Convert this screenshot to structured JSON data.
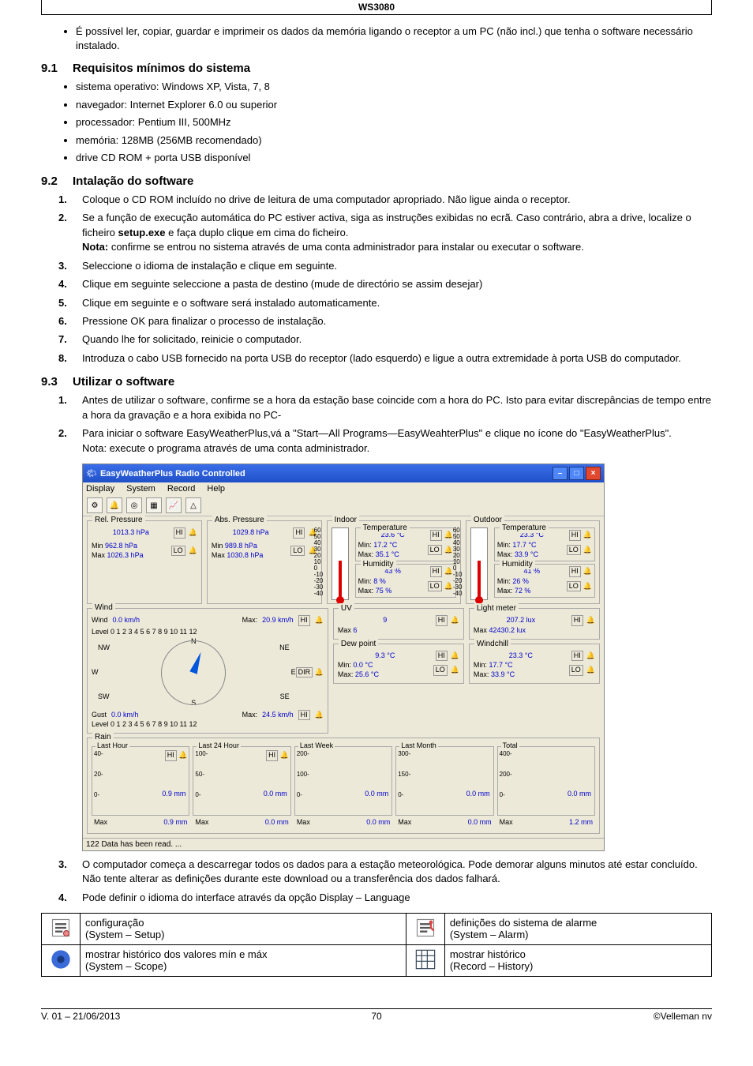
{
  "header": {
    "title": "WS3080"
  },
  "intro_bullet": "É possível ler, copiar, guardar e imprimeir os dados da memória ligando o receptor a um PC (não incl.) que tenha o software necessário instalado.",
  "section91": {
    "num": "9.1",
    "title": "Requisitos mínimos do sistema",
    "items": [
      "sistema operativo: Windows XP, Vista, 7, 8",
      "navegador: Internet Explorer 6.0 ou superior",
      "processador: Pentium III, 500MHz",
      "memória: 128MB (256MB recomendado)",
      "drive CD ROM + porta USB disponível"
    ]
  },
  "section92": {
    "num": "9.2",
    "title": "Intalação do software",
    "steps": [
      "Coloque o CD ROM incluído no drive de leitura de uma computador apropriado. Não ligue ainda o receptor.",
      "Se a função de execução automática do PC estiver activa, siga as instruções exibidas no ecrã. Caso contrário, abra a drive, localize o ficheiro <b>setup.exe</b> e faça duplo clique em cima do ficheiro.<br><b>Nota:</b> confirme se entrou no sistema através de uma conta administrador para instalar ou executar o software.",
      "Seleccione o idioma de instalação e clique em seguinte.",
      "Clique em seguinte seleccione a pasta de destino (mude de directório se assim desejar)",
      "Clique em seguinte e o software será instalado automaticamente.",
      "Pressione OK para finalizar o processo de instalação.",
      "Quando lhe for solicitado, reinicie o computador.",
      "Introduza o cabo USB fornecido na porta USB do receptor (lado esquerdo) e ligue a outra extremidade à porta USB do computador."
    ]
  },
  "section93": {
    "num": "9.3",
    "title": "Utilizar o software",
    "steps": [
      "Antes de utilizar o software, confirme se a hora da estação base coincide com a hora do PC. Isto para evitar discrepâncias de tempo entre a hora da gravação e a hora exibida no PC-",
      "Para iniciar o software EasyWeatherPlus,vá a \"Start—All Programs—EasyWeahterPlus\" e clique no ícone do \"EasyWeatherPlus\".<br>Nota: execute o programa através de uma conta administrador."
    ],
    "steps2": [
      "O computador começa a descarregar todos os dados para a estação meteorológica. Pode demorar alguns minutos até estar concluído. Não tente alterar as definições durante este download ou a transferência dos dados falhará.",
      "Pode definir o idioma do interface através da opção Display – Language"
    ]
  },
  "app": {
    "title": "EasyWeatherPlus Radio Controlled",
    "menu": [
      "Display",
      "System",
      "Record",
      "Help"
    ],
    "rel_pressure": {
      "legend": "Rel. Pressure",
      "value": "1013.3 hPa",
      "hi": "HI",
      "min_label": "Min",
      "min": "962.8 hPa",
      "max_label": "Max",
      "max": "1026.3 hPa",
      "lo": "LO"
    },
    "abs_pressure": {
      "legend": "Abs. Pressure",
      "value": "1029.8 hPa",
      "hi": "HI",
      "min_label": "Min",
      "min": "989.8 hPa",
      "max_label": "Max",
      "max": "1030.8 hPa",
      "lo": "LO"
    },
    "wind": {
      "legend": "Wind",
      "label": "Wind",
      "value": "0.0 km/h",
      "max_label": "Max:",
      "max": "20.9 km/h",
      "hi": "HI",
      "level_label": "Level",
      "dir_label": "DIR",
      "dirs": {
        "n": "N",
        "ne": "NE",
        "e": "E",
        "se": "SE",
        "s": "S",
        "sw": "SW",
        "w": "W",
        "nw": "NW"
      },
      "gust_label": "Gust",
      "gust": "0.0 km/h",
      "gust_max_label": "Max:",
      "gust_max": "24.5 km/h",
      "gust_hi": "HI",
      "scale": "0  1  2  3  4  5  6  7  8  9  10  11  12"
    },
    "indoor": {
      "legend": "Indoor",
      "temp_legend": "Temperature",
      "temp": "23.6 °C",
      "hi": "HI",
      "lo": "LO",
      "min_label": "Min:",
      "min": "17.2 °C",
      "max_label": "Max:",
      "max": "35.1 °C",
      "hum_legend": "Humidity",
      "hum": "43 %",
      "hum_min_label": "Min:",
      "hum_min": "8 %",
      "hum_max_label": "Max:",
      "hum_max": "75 %",
      "ticks": "60\n50\n40\n30\n20\n10\n0\n-10\n-20\n-30\n-40"
    },
    "outdoor": {
      "legend": "Outdoor",
      "temp_legend": "Temperature",
      "temp": "23.3 °C",
      "hi": "HI",
      "lo": "LO",
      "min_label": "Min:",
      "min": "17.7 °C",
      "max_label": "Max:",
      "max": "33.9 °C",
      "hum_legend": "Humidity",
      "hum": "41 %",
      "hum_min_label": "Min:",
      "hum_min": "26 %",
      "hum_max_label": "Max:",
      "hum_max": "72 %"
    },
    "uv": {
      "legend": "UV",
      "value": "9",
      "max_label": "Max",
      "max": "6",
      "hi": "HI"
    },
    "light": {
      "legend": "Light meter",
      "value": "207.2 lux",
      "max_label": "Max",
      "max": "42430.2 lux",
      "hi": "HI"
    },
    "dew": {
      "legend": "Dew point",
      "value": "9.3 °C",
      "hi": "HI",
      "min_label": "Min:",
      "min": "0.0 °C",
      "max_label": "Max:",
      "max": "25.6 °C",
      "lo": "LO"
    },
    "windchill": {
      "legend": "Windchill",
      "value": "23.3 °C",
      "hi": "HI",
      "min_label": "Min:",
      "min": "17.7 °C",
      "max_label": "Max:",
      "max": "33.9 °C",
      "lo": "LO"
    },
    "rain": {
      "legend": "Rain",
      "cols": [
        {
          "legend": "Last Hour",
          "hi": "HI",
          "value": "0.9 mm",
          "max_label": "Max",
          "max": "0.9 mm",
          "top": "40",
          "mid": "20",
          "bot": "0"
        },
        {
          "legend": "Last 24 Hour",
          "hi": "HI",
          "value": "0.0 mm",
          "max_label": "Max",
          "max": "0.0 mm",
          "top": "100",
          "mid": "50",
          "bot": "0"
        },
        {
          "legend": "Last Week",
          "value": "0.0 mm",
          "max_label": "Max",
          "max": "0.0 mm",
          "top": "200",
          "mid": "100",
          "bot": "0"
        },
        {
          "legend": "Last Month",
          "value": "0.0 mm",
          "max_label": "Max",
          "max": "0.0 mm",
          "top": "300",
          "mid": "150",
          "bot": "0"
        },
        {
          "legend": "Total",
          "value": "0.0 mm",
          "max_label": "Max",
          "max": "1.2 mm",
          "top": "400",
          "mid": "200",
          "bot": "0"
        }
      ]
    },
    "status": "122 Data has been read. ..."
  },
  "config_table": {
    "rows": [
      {
        "left": "configuração<br>(System – Setup)",
        "right": "definições do sistema de alarme<br>(System – Alarm)"
      },
      {
        "left": "mostrar histórico dos valores mín e máx<br>(System – Scope)",
        "right": "mostrar histórico<br>(Record – History)"
      }
    ]
  },
  "footer": {
    "left": "V. 01 – 21/06/2013",
    "center": "70",
    "right": "©Velleman nv"
  }
}
